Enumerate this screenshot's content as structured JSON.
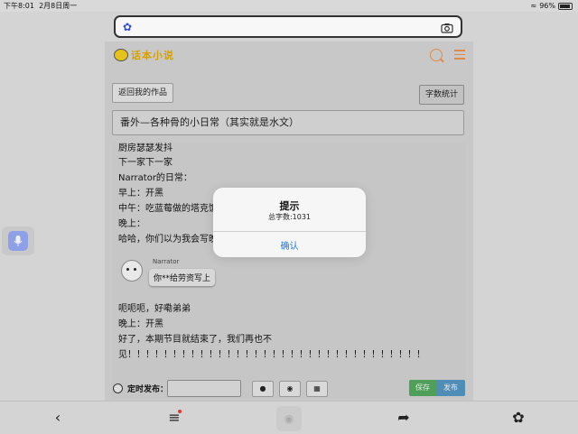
{
  "status_bar": {
    "time": "下午8:01",
    "date": "2月8日周一",
    "battery": "96%"
  },
  "search_bar": {
    "value": ""
  },
  "header": {
    "logo_text": "话本小说"
  },
  "toolbar": {
    "back_label": "返回我的作品",
    "word_count_label": "字数统计"
  },
  "title_field": {
    "value": "番外—各种骨的小日常（其实就是水文）"
  },
  "editor": {
    "lines": [
      "厨房瑟瑟发抖",
      "下一家下一家",
      "Narrator的日常：",
      "早上：开黑",
      "中午：吃蓝莓做的塔克饭",
      "晚上：",
      "哈哈，你们以为我会写晚",
      "呃呃呃，好嘞弟弟",
      "晚上：开黑",
      "好了，本期节目就结束了，我们再也不",
      "见！！！！！！！！！！！！！！！！！！！！！！！！！！！！！！！！！"
    ],
    "dialogue": {
      "speaker": "Narrator",
      "text": "你**给劳资写上"
    }
  },
  "bottom": {
    "schedule_label": "定时发布：",
    "schedule_value": "",
    "save_label": "保存",
    "publish_label": "发布"
  },
  "dialog": {
    "title": "提示",
    "message": "总字数:1031",
    "confirm_label": "确认"
  },
  "colors": {
    "accent_orange": "#e08a4a",
    "link_blue": "#1a78e0",
    "save_green": "#4f9f5b",
    "publish_blue": "#4f8cb6"
  }
}
